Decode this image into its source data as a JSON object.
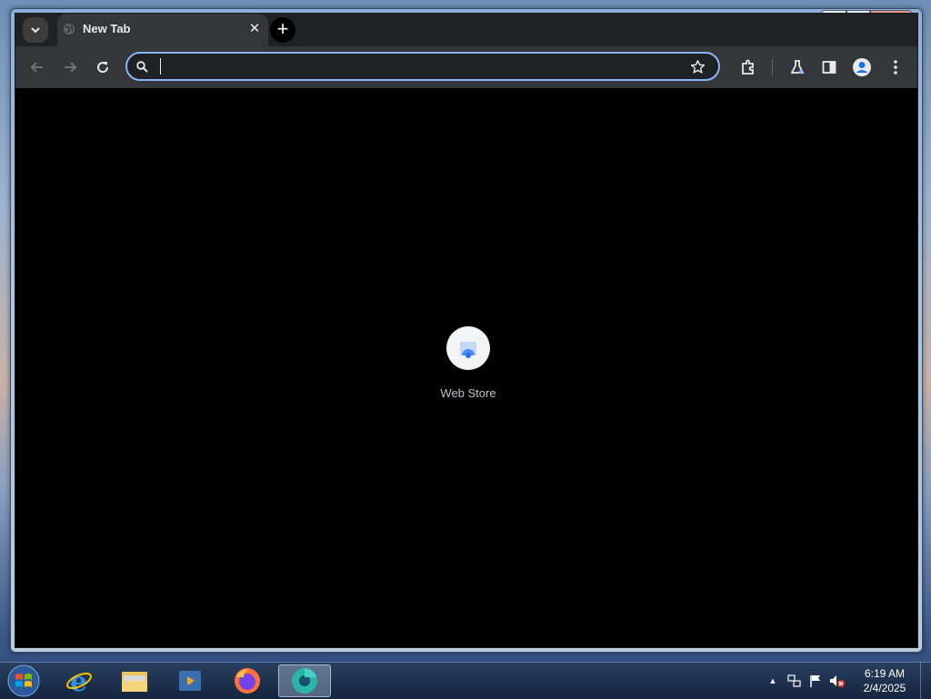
{
  "browser": {
    "tab_title": "New Tab",
    "omnibox": {
      "value": "",
      "placeholder": ""
    },
    "new_tab_page": {
      "shortcuts": [
        {
          "label": "Web Store"
        }
      ]
    }
  },
  "taskbar": {
    "clock": {
      "time": "6:19 AM",
      "date": "2/4/2025"
    },
    "pinned_apps": [
      {
        "name": "internet-explorer"
      },
      {
        "name": "file-explorer"
      },
      {
        "name": "media-player"
      },
      {
        "name": "firefox"
      },
      {
        "name": "chrome-active"
      }
    ]
  },
  "colors": {
    "accent": "#8ab4f8",
    "toolbar": "#35363a",
    "tabstrip": "#202124",
    "content_bg": "#000000"
  }
}
